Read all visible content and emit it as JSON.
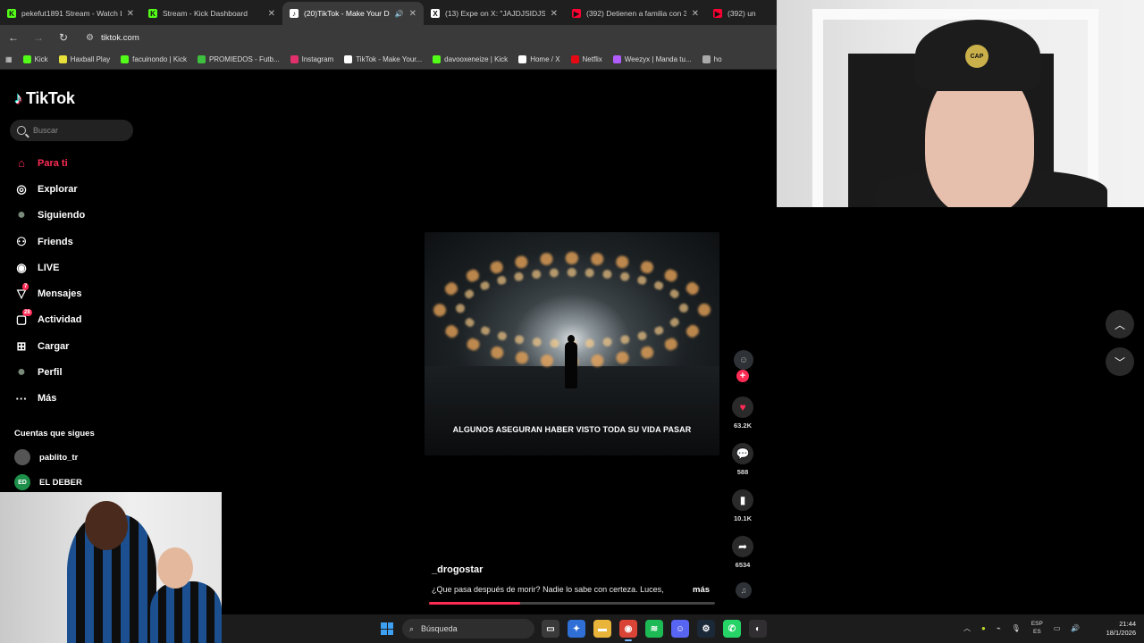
{
  "browser": {
    "tabs": [
      {
        "title": "pekefut1891 Stream - Watch Li...",
        "favicon": "kick-icon",
        "color": "#53fc18",
        "active": false
      },
      {
        "title": "Stream - Kick Dashboard",
        "favicon": "kick-icon",
        "color": "#53fc18",
        "active": false
      },
      {
        "title": "(20)TikTok - Make Your Day",
        "favicon": "tiktok-icon",
        "color": "#ffffff",
        "active": true
      },
      {
        "title": "(13) Expe on X: \"JAJDJSIDJSKS ...",
        "favicon": "x-icon",
        "color": "#ffffff",
        "active": false
      },
      {
        "title": "(392) Detienen a familia con 35...",
        "favicon": "youtube-icon",
        "color": "#ff0033",
        "active": false
      },
      {
        "title": "(392) un",
        "favicon": "youtube-icon",
        "color": "#ff0033",
        "active": false
      }
    ],
    "url": "tiktok.com",
    "bookmarks": [
      {
        "label": "Kick",
        "color": "#53fc18"
      },
      {
        "label": "Haxball Play",
        "color": "#e8e03a"
      },
      {
        "label": "facuinondo | Kick",
        "color": "#53fc18"
      },
      {
        "label": "PROMIEDOS - Futb...",
        "color": "#3fbf3f"
      },
      {
        "label": "Instagram",
        "color": "#e1306c"
      },
      {
        "label": "TikTok - Make Your...",
        "color": "#ffffff"
      },
      {
        "label": "davooxeneize | Kick",
        "color": "#53fc18"
      },
      {
        "label": "Home / X",
        "color": "#ffffff"
      },
      {
        "label": "Netflix",
        "color": "#e50914"
      },
      {
        "label": "Weezyx | Manda tu...",
        "color": "#b05cff"
      },
      {
        "label": "ho",
        "color": "#aaaaaa"
      }
    ]
  },
  "tiktok": {
    "brand": "TikTok",
    "search_placeholder": "Buscar",
    "nav": [
      {
        "label": "Para ti",
        "icon": "home-icon",
        "glyph": "⌂",
        "active": true
      },
      {
        "label": "Explorar",
        "icon": "compass-icon",
        "glyph": "◎",
        "active": false
      },
      {
        "label": "Siguiendo",
        "icon": "following-avatar-icon",
        "glyph": "●",
        "active": false
      },
      {
        "label": "Friends",
        "icon": "friends-icon",
        "glyph": "⚇",
        "active": false
      },
      {
        "label": "LIVE",
        "icon": "live-icon",
        "glyph": "◉",
        "active": false
      },
      {
        "label": "Mensajes",
        "icon": "messages-icon",
        "glyph": "▽",
        "badge": "7",
        "active": false
      },
      {
        "label": "Actividad",
        "icon": "activity-icon",
        "glyph": "▢",
        "badge": "28",
        "active": false
      },
      {
        "label": "Cargar",
        "icon": "upload-icon",
        "glyph": "⊞",
        "active": false
      },
      {
        "label": "Perfil",
        "icon": "profile-avatar-icon",
        "glyph": "●",
        "active": false
      },
      {
        "label": "Más",
        "icon": "more-icon",
        "glyph": "···",
        "active": false
      }
    ],
    "following_header": "Cuentas que sigues",
    "following": [
      {
        "name": "pablito_tr",
        "initials": "",
        "color": "#555555"
      },
      {
        "name": "EL DEBER",
        "initials": "ED",
        "color": "#1d8f4a"
      }
    ],
    "video": {
      "caption_overlay": "ALGUNOS ASEGURAN HABER VISTO TODA SU VIDA PASAR",
      "author": "_drogostar",
      "description": "¿Que pasa después de morir? Nadie lo sabe con certeza. Luces,",
      "more_label": "más",
      "progress": 0.32,
      "likes": "63.2K",
      "comments": "588",
      "saves": "10.1K",
      "shares": "6534"
    }
  },
  "taskbar": {
    "search_label": "Búsqueda",
    "apps": [
      {
        "name": "task-view-icon",
        "color": "#3a3a3a",
        "glyph": "▭"
      },
      {
        "name": "copilot-icon",
        "color": "#2f6fd6",
        "glyph": "✦"
      },
      {
        "name": "file-explorer-icon",
        "color": "#e8b53a",
        "glyph": "▬"
      },
      {
        "name": "chrome-icon",
        "color": "#d94436",
        "glyph": "◉"
      },
      {
        "name": "spotify-icon",
        "color": "#1db954",
        "glyph": "≋"
      },
      {
        "name": "discord-icon",
        "color": "#5865f2",
        "glyph": "☺"
      },
      {
        "name": "steam-icon",
        "color": "#1b2838",
        "glyph": "⚙"
      },
      {
        "name": "whatsapp-icon",
        "color": "#25d366",
        "glyph": "✆"
      },
      {
        "name": "obs-icon",
        "color": "#302e31",
        "glyph": "◐"
      }
    ],
    "lang_top": "ESP",
    "lang_bottom": "ES",
    "time": "21:44",
    "date": "18/1/2026"
  }
}
